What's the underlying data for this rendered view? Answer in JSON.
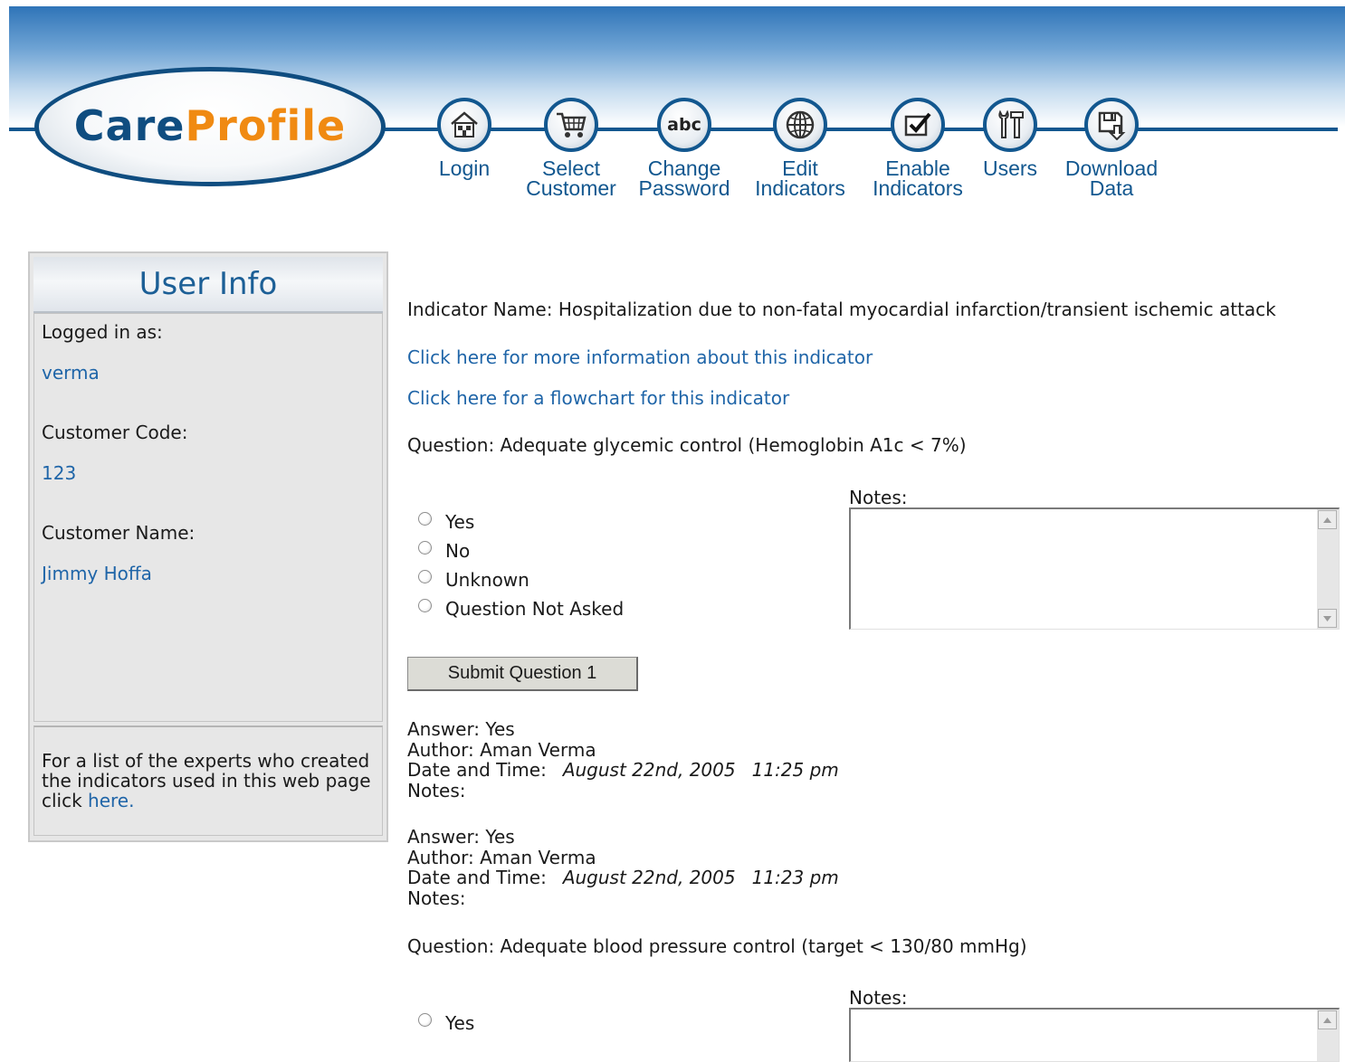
{
  "logo": {
    "care": "Care",
    "profile": "Profile"
  },
  "nav": [
    {
      "line1": "Login",
      "line2": "",
      "icon": "house-icon"
    },
    {
      "line1": "Select",
      "line2": "Customer",
      "icon": "cart-icon"
    },
    {
      "line1": "Change",
      "line2": "Password",
      "icon": "abc-icon"
    },
    {
      "line1": "Edit",
      "line2": "Indicators",
      "icon": "globe-icon"
    },
    {
      "line1": "Enable",
      "line2": "Indicators",
      "icon": "checkbox-icon"
    },
    {
      "line1": "Users",
      "line2": "",
      "icon": "tools-icon"
    },
    {
      "line1": "Download",
      "line2": "Data",
      "icon": "disk-download-icon"
    }
  ],
  "nav_icon_text": {
    "abc": "abc"
  },
  "sidebar": {
    "title": "User Info",
    "logged_in_label": "Logged in as:",
    "username": "verma",
    "customer_code_label": "Customer Code:",
    "customer_code": "123",
    "customer_name_label": "Customer Name:",
    "customer_name": "Jimmy Hoffa",
    "footer_text": "For a list of the experts who created the indicators used in this web page click ",
    "footer_link": "here",
    "footer_end": "."
  },
  "main": {
    "indicator_name": "Indicator Name: Hospitalization due to non-fatal myocardial infarction/transient ischemic attack",
    "info_link": "Click here for more information about this indicator",
    "flowchart_link": "Click here for a flowchart for this indicator",
    "question1": "Question: Adequate glycemic control (Hemoglobin A1c < 7%)",
    "notes_label": "Notes:",
    "options": [
      "Yes",
      "No",
      "Unknown",
      "Question Not Asked"
    ],
    "submit_label": "Submit Question 1",
    "answers": [
      {
        "answer": "Answer: Yes",
        "author": "Author: Aman Verma",
        "dt_label": "Date and Time:",
        "date": "August 22nd, 2005",
        "time": "11:25 pm",
        "notes": "Notes:"
      },
      {
        "answer": "Answer: Yes",
        "author": "Author: Aman Verma",
        "dt_label": "Date and Time:",
        "date": "August 22nd, 2005",
        "time": "11:23 pm",
        "notes": "Notes:"
      }
    ],
    "question2": "Question: Adequate blood pressure control (target < 130/80 mmHg)",
    "q2_first_option": "Yes"
  },
  "colors": {
    "brand_blue": "#12578f",
    "brand_orange": "#f08a12",
    "link": "#1f65a8"
  }
}
